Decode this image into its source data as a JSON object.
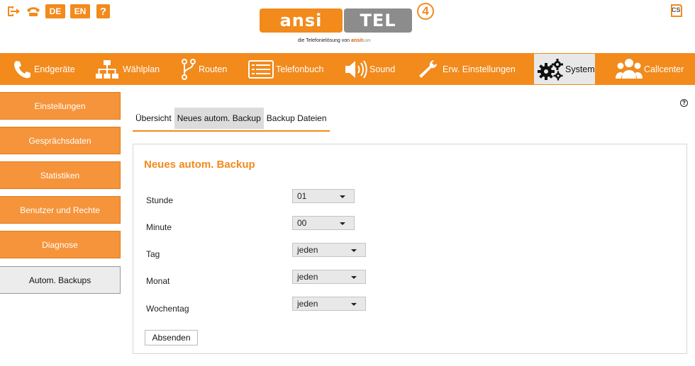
{
  "top": {
    "lang_de": "DE",
    "lang_en": "EN",
    "help_mark": "?",
    "user_badge": "CS"
  },
  "logo": {
    "left_text": "ansi",
    "right_text": "TEL",
    "version": "4",
    "tagline_prefix": "die Telefonielösung von",
    "tagline_brand": "ansit",
    "tagline_suffix": "com"
  },
  "nav": {
    "items": [
      {
        "label": "Endgeräte",
        "icon": "phone-icon"
      },
      {
        "label": "Wählplan",
        "icon": "hierarchy-icon"
      },
      {
        "label": "Routen",
        "icon": "route-icon"
      },
      {
        "label": "Telefonbuch",
        "icon": "phonebook-icon"
      },
      {
        "label": "Sound",
        "icon": "speaker-icon"
      },
      {
        "label": "Erw. Einstellungen",
        "icon": "wrench-icon"
      },
      {
        "label": "System",
        "icon": "gears-icon"
      },
      {
        "label": "Callcenter",
        "icon": "users-icon"
      }
    ],
    "active": "System"
  },
  "sidebar": {
    "items": [
      {
        "label": "Einstellungen"
      },
      {
        "label": "Gesprächsdaten"
      },
      {
        "label": "Statistiken"
      },
      {
        "label": "Benutzer und Rechte"
      },
      {
        "label": "Diagnose"
      },
      {
        "label": "Autom. Backups"
      }
    ],
    "active": "Autom. Backups"
  },
  "tabs": {
    "items": [
      {
        "label": "Übersicht"
      },
      {
        "label": "Neues autom. Backup"
      },
      {
        "label": "Backup Dateien"
      }
    ],
    "active": "Neues autom. Backup"
  },
  "help_icon": "?",
  "form": {
    "title": "Neues autom. Backup",
    "fields": [
      {
        "label": "Stunde",
        "value": "01"
      },
      {
        "label": "Minute",
        "value": "00"
      },
      {
        "label": "Tag",
        "value": "jeden"
      },
      {
        "label": "Monat",
        "value": "jeden"
      },
      {
        "label": "Wochentag",
        "value": "jeden"
      }
    ],
    "submit_label": "Absenden"
  },
  "colors": {
    "accent": "#f28a1c",
    "logo_gray": "#8c8c8c"
  }
}
